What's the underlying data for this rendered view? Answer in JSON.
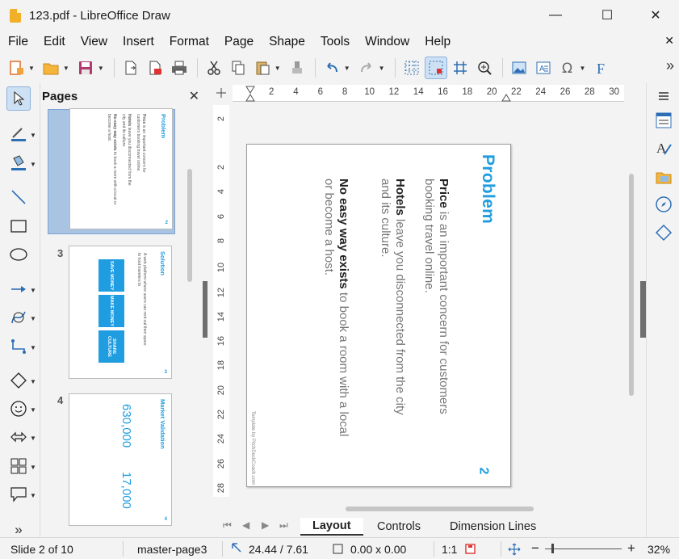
{
  "window": {
    "title": "123.pdf - LibreOffice Draw",
    "minimize_glyph": "—",
    "maximize_glyph": "☐",
    "close_glyph": "✕"
  },
  "menu": {
    "items": [
      "File",
      "Edit",
      "View",
      "Insert",
      "Format",
      "Page",
      "Shape",
      "Tools",
      "Window",
      "Help"
    ],
    "close_glyph": "✕"
  },
  "toolbar": {
    "more_glyph": "»",
    "icons": [
      "template-icon",
      "open-icon",
      "save-icon",
      "export-icon",
      "export-pdf-icon",
      "print-icon",
      "cut-icon",
      "copy-icon",
      "paste-icon",
      "clone-formatting-icon",
      "undo-icon",
      "redo-icon",
      "grid-icon",
      "helplines-icon",
      "snap-guides-icon",
      "zoom-pan-icon",
      "image-icon",
      "text-box-icon",
      "special-character-icon",
      "fontwork-icon"
    ]
  },
  "pages_panel": {
    "title": "Pages",
    "close_glyph": "✕",
    "thumbnails": [
      {
        "number": "",
        "title": "Problem",
        "page_number": "2",
        "selected": true
      },
      {
        "number": "3",
        "title": "Solution",
        "page_number": "3",
        "subtitle": "A web platform where users can rent out their spare to host travelers to",
        "boxes": [
          "SAVE MONEY",
          "MAKE MONEY",
          "SHARE CULTURE"
        ],
        "selected": false
      },
      {
        "number": "4",
        "title": "Market Validation",
        "page_number": "4",
        "stats": [
          "630,000",
          "17,000"
        ],
        "selected": false
      }
    ]
  },
  "ruler": {
    "h_ticks": [
      "2",
      "4",
      "6",
      "8",
      "10",
      "12",
      "14",
      "16",
      "18",
      "20",
      "22",
      "24",
      "26",
      "28",
      "30"
    ],
    "v_ticks": [
      "2",
      "2",
      "4",
      "6",
      "8",
      "10",
      "12",
      "14",
      "16",
      "18",
      "20",
      "22",
      "24",
      "26",
      "28"
    ]
  },
  "slide": {
    "title": "Problem",
    "para1_bold": "Price",
    "para1_rest": " is an important concern for customers booking travel online.",
    "para2_bold": "Hotels",
    "para2_rest": " leave you disconnected from the city and its culture.",
    "para3_bold": "No easy way exists",
    "para3_rest": " to book a room with a local or become a host.",
    "footer": "Template by PitchDeckCoach.com",
    "page_number": "2"
  },
  "tabs": {
    "items": [
      "Layout",
      "Controls",
      "Dimension Lines"
    ],
    "active": "Layout"
  },
  "status": {
    "slide": "Slide 2 of 10",
    "master": "master-page3",
    "position": "24.44 / 7.61",
    "size": "0.00 x 0.00",
    "scale": "1:1",
    "zoom_minus": "−",
    "zoom_plus": "+",
    "zoom": "32%"
  },
  "colors": {
    "accent": "#1f9de0",
    "selection": "#cde0f4",
    "brand": "#f2b02a"
  }
}
